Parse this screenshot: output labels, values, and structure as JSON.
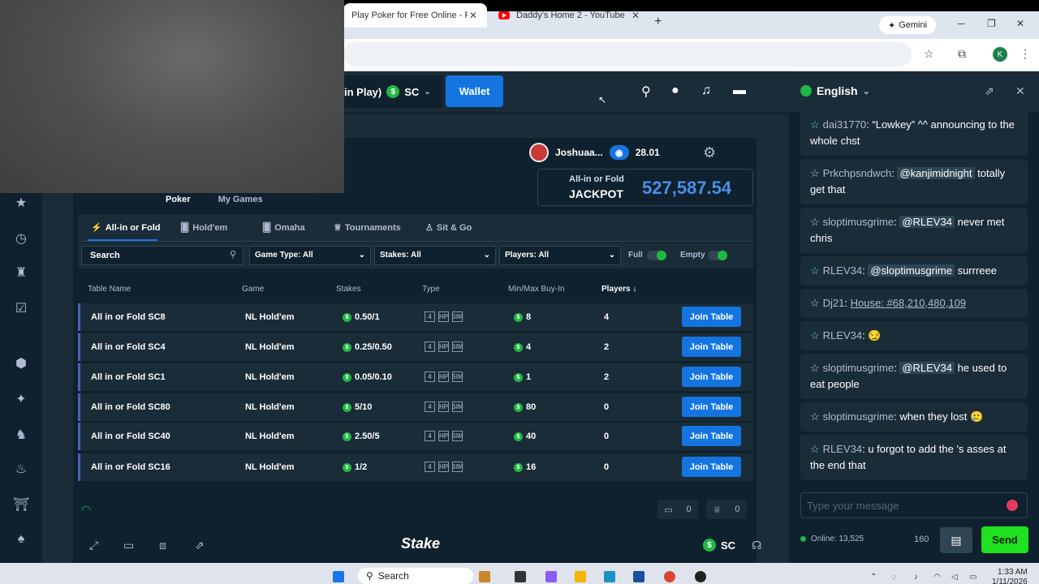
{
  "browser": {
    "tabs": [
      {
        "title": "Play Poker for Free Online - Fre",
        "active": true
      },
      {
        "title": "Daddy's Home 2 - YouTube",
        "active": false
      }
    ],
    "new_tab": "+",
    "gemini_label": "Gemini",
    "profile_initial": "K"
  },
  "header": {
    "balance_prefix": "in Play)",
    "currency": "SC",
    "wallet_label": "Wallet"
  },
  "player": {
    "name": "Joshuaa...",
    "value": "28.01"
  },
  "jackpot": {
    "small": "All-in or Fold",
    "big": "JACKPOT",
    "amount": "527,587.54"
  },
  "top_tabs": [
    "Poker",
    "My Games"
  ],
  "game_tabs": [
    "All-in or Fold",
    "Hold'em",
    "Omaha",
    "Tournaments",
    "Sit & Go"
  ],
  "filters": {
    "search_placeholder": "Search",
    "game_type": "Game Type: All",
    "stakes": "Stakes: All",
    "players": "Players: All",
    "full": "Full",
    "empty": "Empty"
  },
  "columns": [
    "Table Name",
    "Game",
    "Stakes",
    "Type",
    "Min/Max Buy-In",
    "Players ↓"
  ],
  "rows": [
    {
      "name": "All in or Fold SC8",
      "game": "NL Hold'em",
      "stakes": "0.50/1",
      "buyin": "8",
      "players": "4",
      "join": "Join Table"
    },
    {
      "name": "All in or Fold SC4",
      "game": "NL Hold'em",
      "stakes": "0.25/0.50",
      "buyin": "4",
      "players": "2",
      "join": "Join Table"
    },
    {
      "name": "All in or Fold SC1",
      "game": "NL Hold'em",
      "stakes": "0.05/0.10",
      "buyin": "1",
      "players": "2",
      "join": "Join Table"
    },
    {
      "name": "All in or Fold SC80",
      "game": "NL Hold'em",
      "stakes": "5/10",
      "buyin": "80",
      "players": "0",
      "join": "Join Table"
    },
    {
      "name": "All in or Fold SC40",
      "game": "NL Hold'em",
      "stakes": "2.50/5",
      "buyin": "40",
      "players": "0",
      "join": "Join Table"
    },
    {
      "name": "All in or Fold SC16",
      "game": "NL Hold'em",
      "stakes": "1/2",
      "buyin": "16",
      "players": "0",
      "join": "Join Table"
    }
  ],
  "type_badges": [
    "4",
    "HP",
    "SIM"
  ],
  "counts": {
    "tables": "0",
    "tournaments": "0"
  },
  "footer": {
    "logo": "Stake",
    "currency": "SC"
  },
  "chat": {
    "language": "English",
    "messages": [
      {
        "user": "dai31770",
        "text": "“Lowkey” ^^ announcing to the whole chst",
        "vip": true
      },
      {
        "user": "Prkchpsndwch",
        "mention": "@kanjimidnight",
        "text": "totally get that",
        "vip": false
      },
      {
        "user": "sloptimusgrime",
        "mention": "@RLEV34",
        "text": "never met chris",
        "vip": false
      },
      {
        "user": "RLEV34",
        "mention": "@sloptimusgrime",
        "text": "surrreee",
        "vip": true
      },
      {
        "user": "Dj21",
        "link": "House: #68,210,480,109",
        "vip": false
      },
      {
        "user": "RLEV34",
        "text": "😏",
        "vip": true
      },
      {
        "user": "sloptimusgrime",
        "mention": "@RLEV34",
        "text": "he used to eat people",
        "vip": false
      },
      {
        "user": "sloptimusgrime",
        "text": "when they lost 🥲",
        "vip": false
      },
      {
        "user": "RLEV34",
        "text": "u forgot to add the 's asses at the end that",
        "vip": true
      }
    ],
    "input_placeholder": "Type your message",
    "online": "Online: 13,525",
    "char_limit": "160",
    "send_label": "Send"
  },
  "taskbar": {
    "search_label": "Search",
    "time": "1:33 AM",
    "date": "1/11/2026"
  },
  "colors": {
    "accent_blue": "#1475e1",
    "sc_green": "#1fb843",
    "send_green": "#1fe11f",
    "bg_dark": "#0f212e",
    "bg_mid": "#1a2c38"
  }
}
